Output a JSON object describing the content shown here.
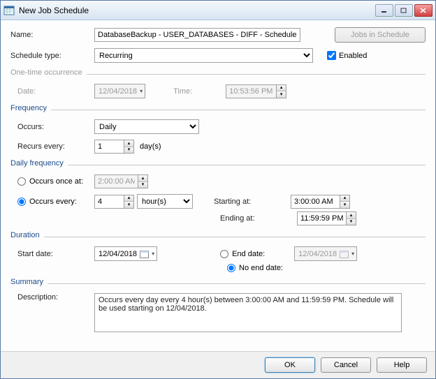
{
  "window": {
    "title": "New Job Schedule"
  },
  "labels": {
    "name": "Name:",
    "schedule_type": "Schedule type:",
    "enabled": "Enabled",
    "one_time": "One-time occurrence",
    "date": "Date:",
    "time": "Time:",
    "frequency": "Frequency",
    "occurs": "Occurs:",
    "recurs_every": "Recurs every:",
    "days_suffix": "day(s)",
    "daily_frequency": "Daily frequency",
    "occurs_once_at": "Occurs once at:",
    "occurs_every": "Occurs every:",
    "starting_at": "Starting at:",
    "ending_at": "Ending at:",
    "duration": "Duration",
    "start_date": "Start date:",
    "end_date": "End date:",
    "no_end_date": "No end date:",
    "summary": "Summary",
    "description": "Description:"
  },
  "buttons": {
    "jobs_in_schedule": "Jobs in Schedule",
    "ok": "OK",
    "cancel": "Cancel",
    "help": "Help"
  },
  "values": {
    "name": "DatabaseBackup - USER_DATABASES - DIFF - Schedule",
    "schedule_type_selected": "Recurring",
    "enabled_checked": true,
    "one_time_date": "12/04/2018",
    "one_time_time": "10:53:56 PM",
    "occurs_selected": "Daily",
    "recurs_every": "1",
    "occurs_once_time": "2:00:00 AM",
    "occurs_every_n": "4",
    "occurs_every_unit": "hour(s)",
    "starting_at": "3:00:00 AM",
    "ending_at": "11:59:59 PM",
    "start_date": "12/04/2018",
    "end_date": "12/04/2018",
    "daily_freq_mode": "every",
    "duration_mode": "noend",
    "description": "Occurs every day every 4 hour(s) between 3:00:00 AM and 11:59:59 PM. Schedule will be used starting on 12/04/2018."
  },
  "options": {
    "schedule_type": [
      "Recurring"
    ],
    "occurs": [
      "Daily"
    ],
    "occurs_every_unit": [
      "hour(s)"
    ]
  }
}
